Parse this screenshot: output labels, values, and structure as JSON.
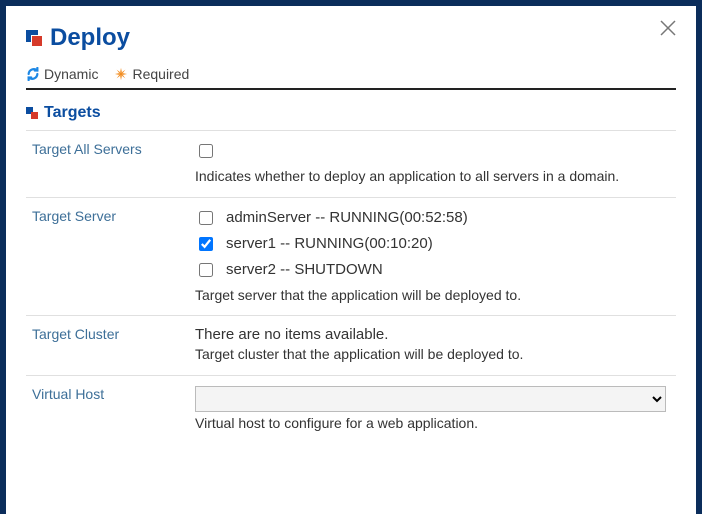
{
  "title": "Deploy",
  "legend": {
    "dynamic": "Dynamic",
    "required": "Required"
  },
  "section_title": "Targets",
  "fields": {
    "target_all": {
      "label": "Target All Servers",
      "help": "Indicates whether to deploy an application to all servers in a domain."
    },
    "target_server": {
      "label": "Target Server",
      "options": [
        {
          "label": "adminServer -- RUNNING(00:52:58)",
          "checked": false
        },
        {
          "label": "server1 -- RUNNING(00:10:20)",
          "checked": true
        },
        {
          "label": "server2 -- SHUTDOWN",
          "checked": false
        }
      ],
      "help": "Target server that the application will be deployed to."
    },
    "target_cluster": {
      "label": "Target Cluster",
      "empty": "There are no items available.",
      "help": "Target cluster that the application will be deployed to."
    },
    "virtual_host": {
      "label": "Virtual Host",
      "help": "Virtual host to configure for a web application."
    }
  }
}
